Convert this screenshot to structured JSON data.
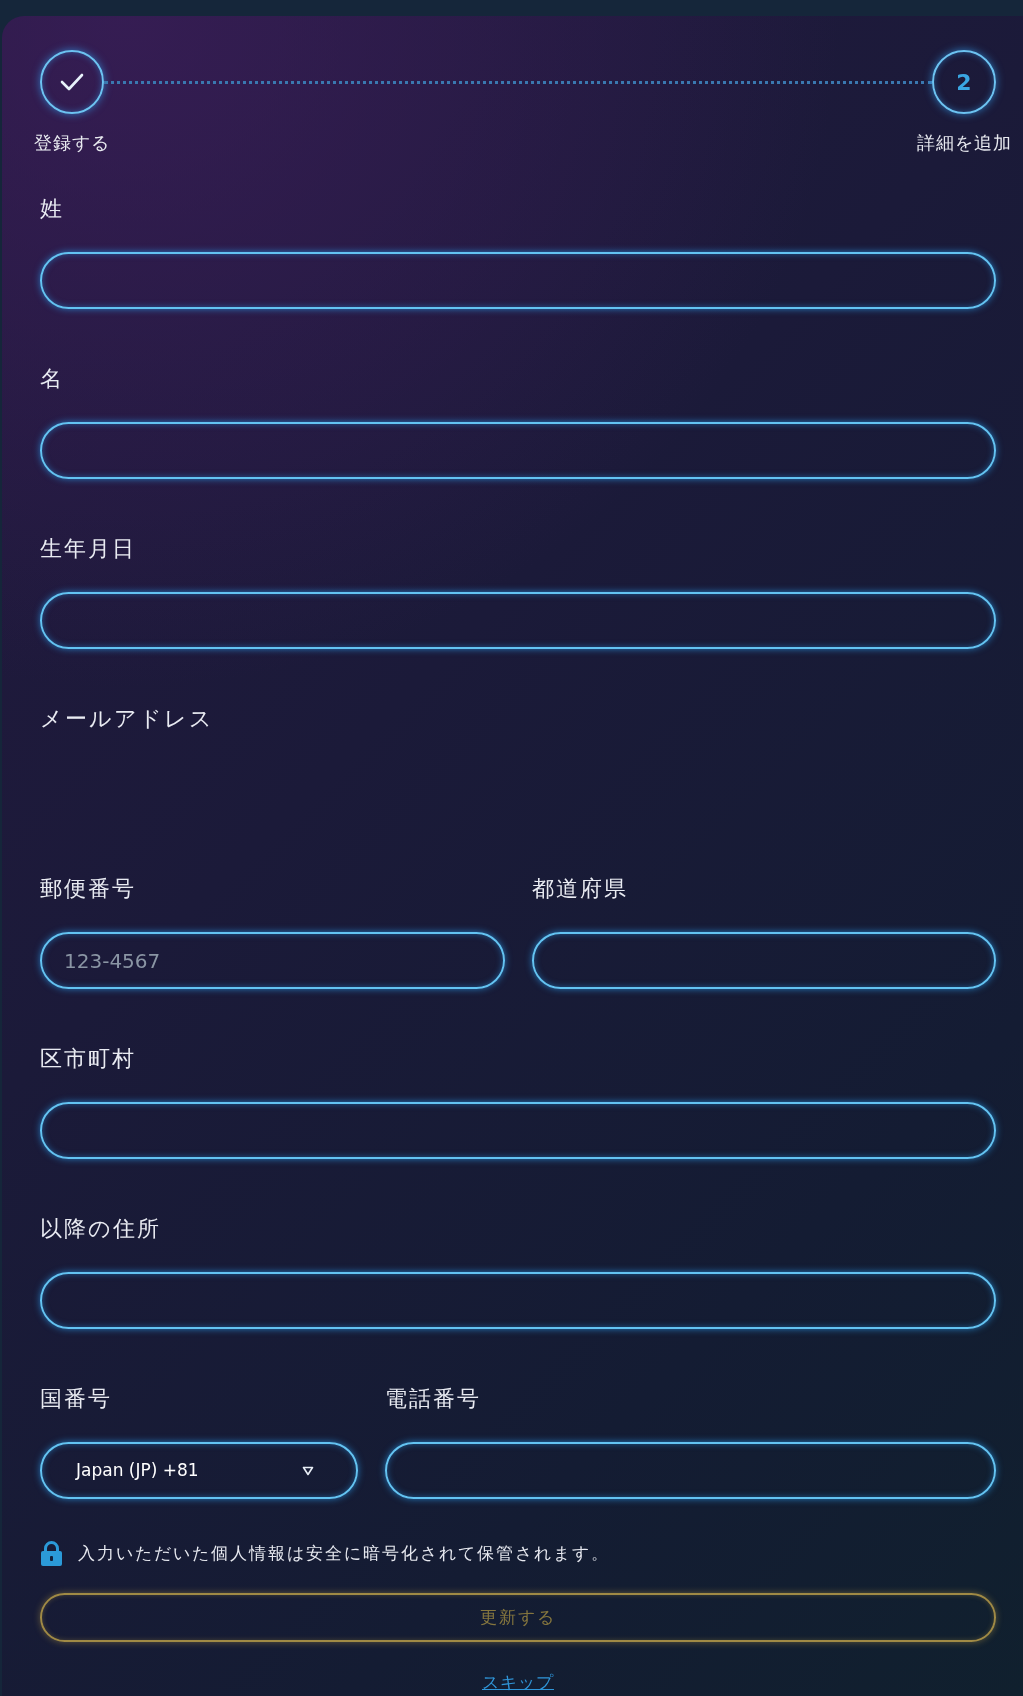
{
  "stepper": {
    "steps": [
      {
        "label": "登録する",
        "completed": true
      },
      {
        "label": "詳細を追加",
        "completed": false,
        "number": "2"
      }
    ]
  },
  "form": {
    "rows": [
      {
        "fields": [
          {
            "kind": "text",
            "label": "姓"
          }
        ]
      },
      {
        "fields": [
          {
            "kind": "text",
            "label": "名"
          }
        ]
      },
      {
        "fields": [
          {
            "kind": "text",
            "label": "生年月日"
          }
        ]
      },
      {
        "fields": [
          {
            "kind": "label_only",
            "label": "メールアドレス"
          }
        ]
      },
      {
        "fields": [
          {
            "kind": "text",
            "label": "郵便番号",
            "placeholder": "123-4567"
          },
          {
            "kind": "text",
            "label": "都道府県"
          }
        ]
      },
      {
        "fields": [
          {
            "kind": "text",
            "label": "区市町村"
          }
        ]
      },
      {
        "fields": [
          {
            "kind": "text",
            "label": "以降の住所"
          }
        ]
      },
      {
        "fields": [
          {
            "kind": "select",
            "label": "国番号",
            "value": "Japan (JP) +81"
          },
          {
            "kind": "text",
            "label": "電話番号"
          }
        ]
      }
    ]
  },
  "notice": {
    "text": "入力いただいた個人情報は安全に暗号化されて保管されます。"
  },
  "submit_button": {
    "label": "更新する",
    "disabled": true
  },
  "skip_link": {
    "label": "スキップ"
  }
}
